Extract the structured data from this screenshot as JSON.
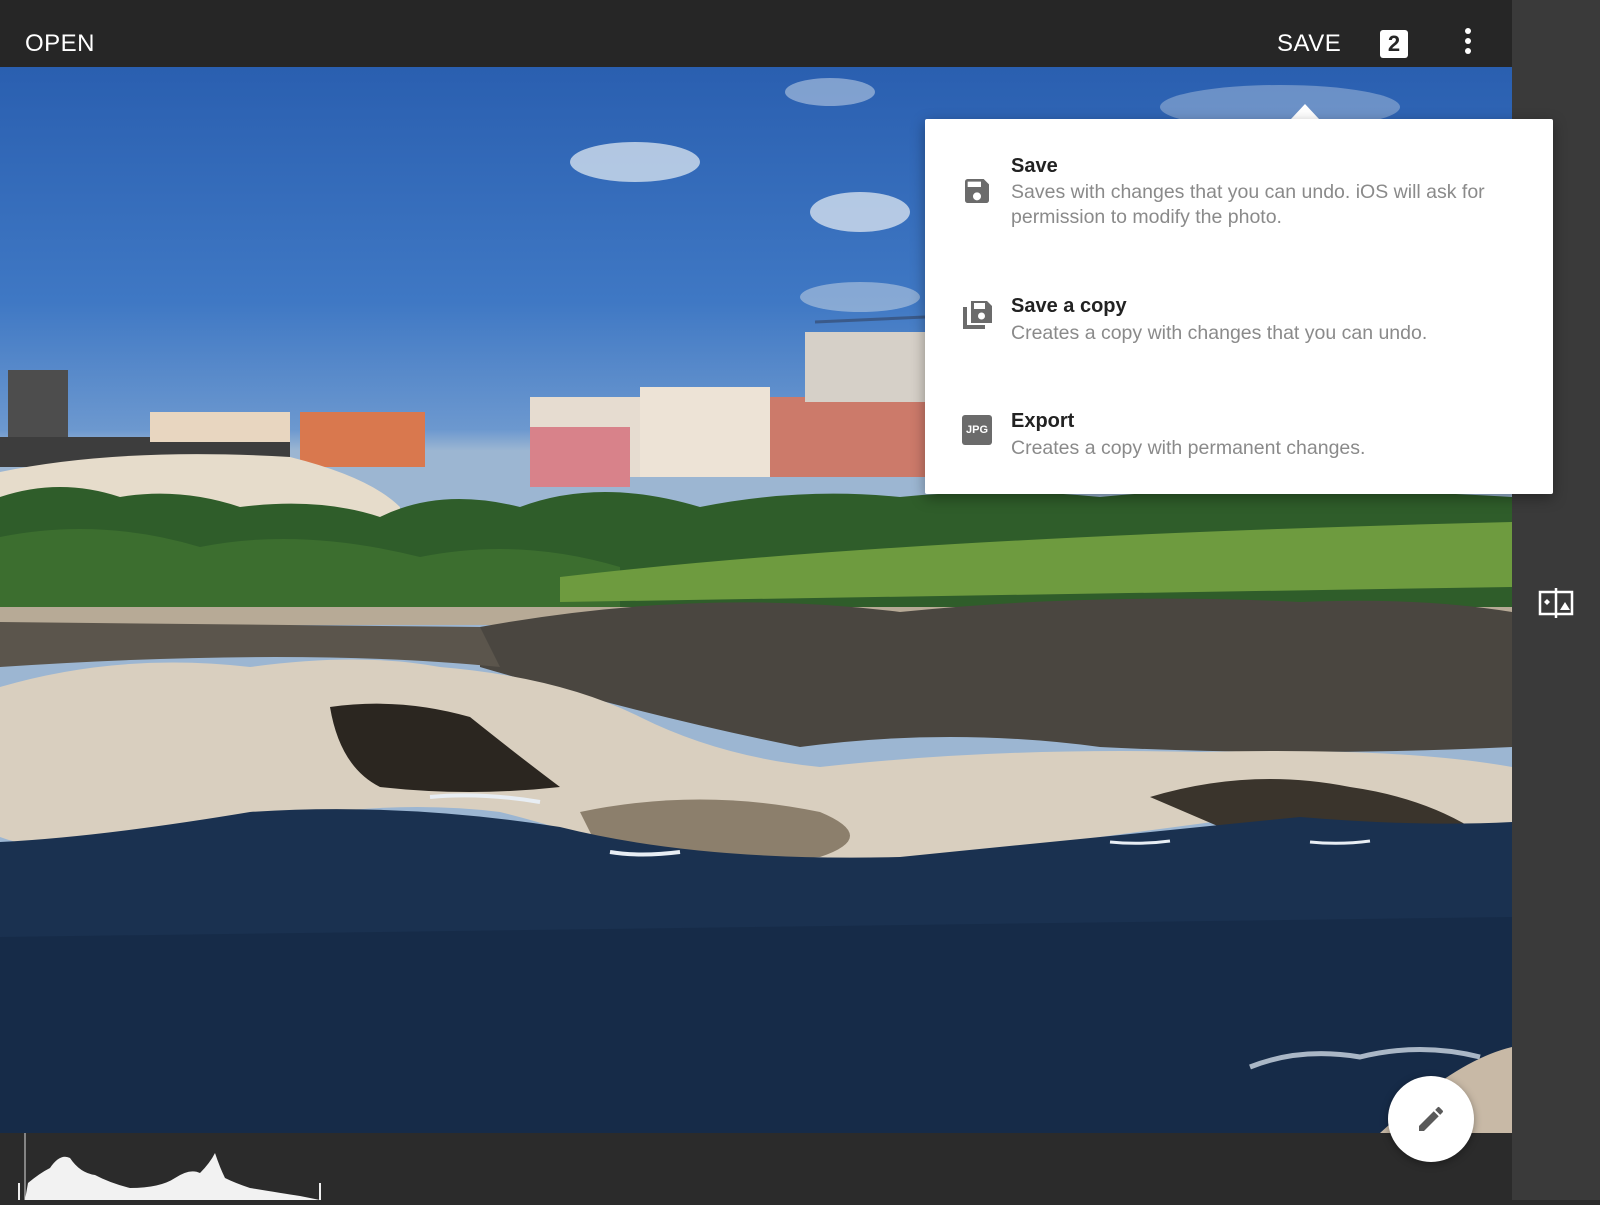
{
  "topbar": {
    "open_label": "OPEN",
    "save_label": "SAVE",
    "layers_count": "2",
    "more_icon": "more-vert-icon"
  },
  "menu": {
    "items": [
      {
        "icon": "floppy-disk-icon",
        "title": "Save",
        "description": "Saves with changes that you can undo. iOS will ask for permission to modify the photo."
      },
      {
        "icon": "save-copy-icon",
        "title": "Save a copy",
        "description": "Creates a copy with changes that you can undo."
      },
      {
        "icon": "jpg-file-icon",
        "icon_text": "JPG",
        "title": "Export",
        "description": "Creates a copy with permanent changes."
      }
    ]
  },
  "right_rail": {
    "icon": "compare-icon"
  },
  "fab": {
    "icon": "pencil-icon"
  },
  "colors": {
    "toolbar": "#262626",
    "rail": "#3a3a3a",
    "menu_bg": "#ffffff"
  }
}
